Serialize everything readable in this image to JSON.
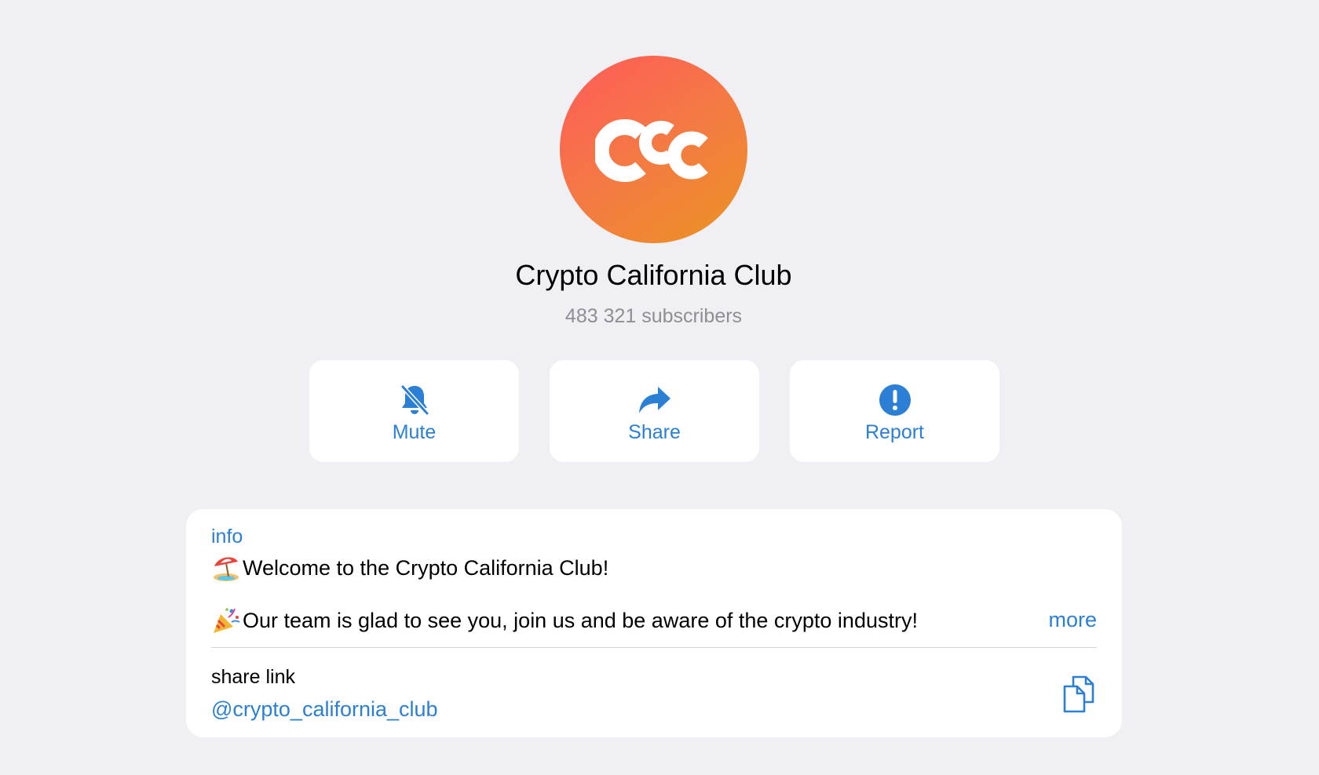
{
  "channel": {
    "title": "Crypto California Club",
    "subscribers": "483 321 subscribers",
    "avatar_icon": "ccc-logo-icon",
    "avatar_gradient": [
      "#ff5a5a",
      "#eb9322"
    ]
  },
  "actions": [
    {
      "label": "Mute",
      "icon": "bell-slash-icon"
    },
    {
      "label": "Share",
      "icon": "share-arrow-icon"
    },
    {
      "label": "Report",
      "icon": "exclamation-circle-icon"
    }
  ],
  "info": {
    "label": "info",
    "lines": [
      {
        "emoji": "beach-umbrella-emoji",
        "text": "Welcome to the Crypto California Club!"
      },
      {
        "emoji": "party-popper-emoji",
        "text": "Our team is glad to see you, join us and be aware of the crypto industry!"
      }
    ],
    "more_label": "more"
  },
  "share_link": {
    "label": "share link",
    "value": "@crypto_california_club",
    "icon": "copy-icon"
  },
  "colors": {
    "accent": "#2b7fd4",
    "background": "#efeff4",
    "secondary_text": "#8e8e93"
  }
}
